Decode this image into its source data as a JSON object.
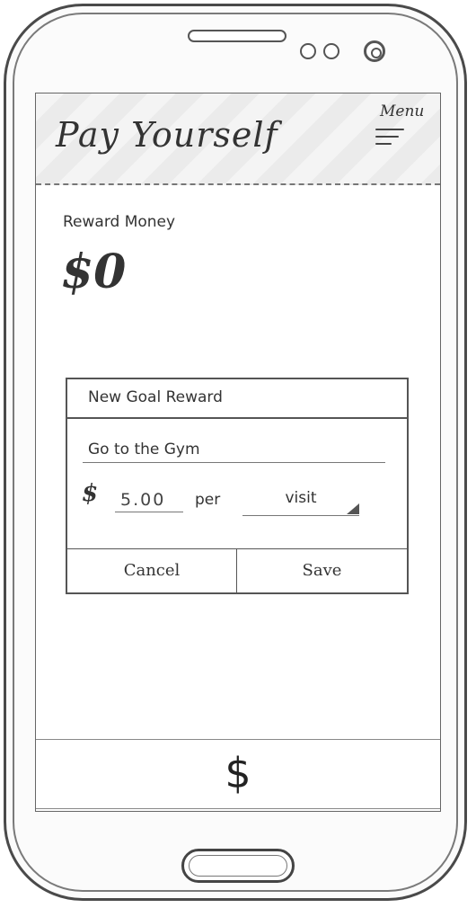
{
  "app": {
    "title": "Pay Yourself",
    "menu_label": "Menu"
  },
  "reward": {
    "label": "Reward Money",
    "amount": "$0"
  },
  "dialog": {
    "title": "New Goal Reward",
    "goal_value": "Go to the Gym",
    "currency_symbol": "$",
    "amount_value": "5.00",
    "per_label": "per",
    "unit_value": "visit",
    "cancel_label": "Cancel",
    "save_label": "Save"
  },
  "bottom_bar": {
    "icon_glyph": "$"
  },
  "icons": {
    "menu": "hamburger-menu-icon",
    "dropdown": "dropdown-arrow-icon",
    "dollar": "dollar-icon"
  }
}
